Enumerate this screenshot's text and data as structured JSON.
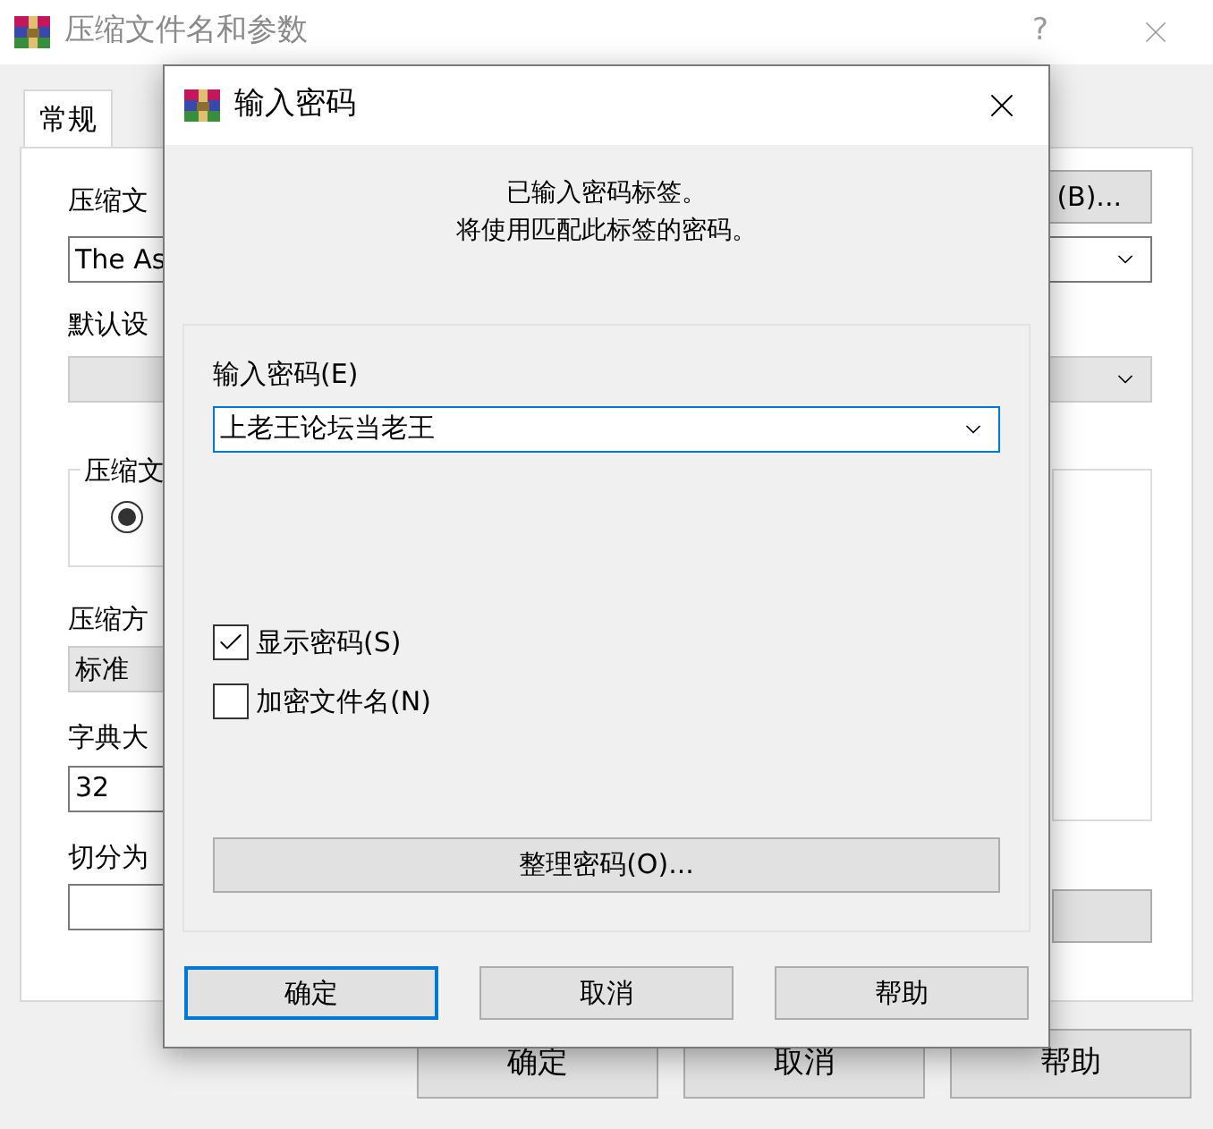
{
  "background": {
    "title": "压缩文件名和参数",
    "help": "?",
    "tabs": [
      {
        "label": "常规",
        "selected": true
      }
    ],
    "archive_name_label": "压缩文",
    "archive_name_value": "The As",
    "browse_button": "(B)...",
    "profile_label": "默认设",
    "format_group_label": "压缩文",
    "format_radio": {
      "selected": true
    },
    "method_label": "压缩方",
    "method_value": "标准",
    "dictionary_label": "字典大",
    "dictionary_value": "32",
    "split_label": "切分为",
    "buttons": [
      "确定",
      "取消",
      "帮助"
    ]
  },
  "dialog": {
    "title": "输入密码",
    "message": [
      "已输入密码标签。",
      "将使用匹配此标签的密码。"
    ],
    "password_label": "输入密码(E)",
    "password_value": "上老王论坛当老王",
    "checkboxes": [
      {
        "label": "显示密码(S)",
        "checked": true
      },
      {
        "label": "加密文件名(N)",
        "checked": false
      }
    ],
    "organize_button": "整理密码(O)...",
    "buttons": [
      {
        "label": "确定",
        "default": true
      },
      {
        "label": "取消",
        "default": false
      },
      {
        "label": "帮助",
        "default": false
      }
    ]
  }
}
